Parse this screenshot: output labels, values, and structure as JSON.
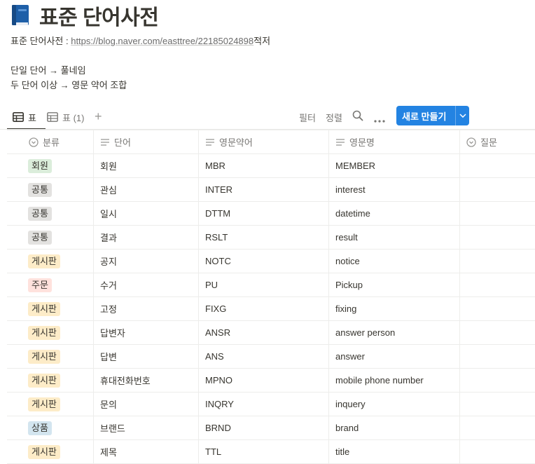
{
  "page": {
    "title": "표준 단어사전",
    "icon": "blue-book-icon",
    "source_prefix": "표준 단어사전 : ",
    "source_link": "https://blog.naver.com/easttree/22185024898",
    "source_suffix": "적저",
    "rule1": "단일 단어 → 풀네임",
    "rule2": "두 단어 이상 → 영문 약어 조합"
  },
  "views": {
    "tab1": "표",
    "tab2": "표 (1)",
    "add_icon": "plus-icon",
    "filter": "필터",
    "sort": "정렬",
    "search_icon": "search-icon",
    "more_icon": "more-icon",
    "new_button": "새로 만들기"
  },
  "table": {
    "headers": [
      "분류",
      "단어",
      "영문약어",
      "영문명",
      "질문"
    ],
    "rows": [
      {
        "category": "회원",
        "word": "회원",
        "abbr": "MBR",
        "name": "MEMBER"
      },
      {
        "category": "공통",
        "word": "관심",
        "abbr": "INTER",
        "name": "interest"
      },
      {
        "category": "공통",
        "word": "일시",
        "abbr": "DTTM",
        "name": "datetime"
      },
      {
        "category": "공통",
        "word": "결과",
        "abbr": "RSLT",
        "name": "result"
      },
      {
        "category": "게시판",
        "word": "공지",
        "abbr": "NOTC",
        "name": "notice"
      },
      {
        "category": "주문",
        "word": "수거",
        "abbr": "PU",
        "name": "Pickup"
      },
      {
        "category": "게시판",
        "word": "고정",
        "abbr": "FIXG",
        "name": "fixing"
      },
      {
        "category": "게시판",
        "word": "답변자",
        "abbr": "ANSR",
        "name": "answer person"
      },
      {
        "category": "게시판",
        "word": "답변",
        "abbr": "ANS",
        "name": "answer"
      },
      {
        "category": "게시판",
        "word": "휴대전화번호",
        "abbr": "MPNO",
        "name": "mobile phone number"
      },
      {
        "category": "게시판",
        "word": "문의",
        "abbr": "INQRY",
        "name": "inquery"
      },
      {
        "category": "상품",
        "word": "브랜드",
        "abbr": "BRND",
        "name": "brand"
      },
      {
        "category": "게시판",
        "word": "제목",
        "abbr": "TTL",
        "name": "title"
      }
    ]
  },
  "tag_colors": {
    "회원": "#dbeddb",
    "공통": "#e3e2e0",
    "게시판": "#fdecc8",
    "주문": "#ffe2dd",
    "상품": "#d3e5ef"
  },
  "colors": {
    "accent": "#2383e2",
    "text": "#37352f",
    "muted": "#787774"
  }
}
